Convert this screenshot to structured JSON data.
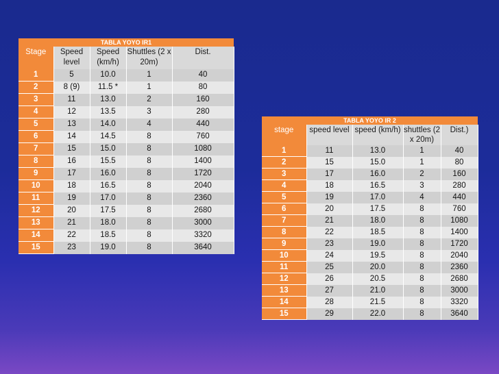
{
  "table1": {
    "title": "TABLA YOYO IR1",
    "headers": [
      "Stage",
      "Speed level",
      "Speed (km/h)",
      "Shuttles (2 x 20m)",
      "Dist."
    ],
    "rows": [
      [
        "1",
        "5",
        "10.0",
        "1",
        "40"
      ],
      [
        "2",
        "8 (9)",
        "11.5 *",
        "1",
        "80"
      ],
      [
        "3",
        "11",
        "13.0",
        "2",
        "160"
      ],
      [
        "4",
        "12",
        "13.5",
        "3",
        "280"
      ],
      [
        "5",
        "13",
        "14.0",
        "4",
        "440"
      ],
      [
        "6",
        "14",
        "14.5",
        "8",
        "760"
      ],
      [
        "7",
        "15",
        "15.0",
        "8",
        "1080"
      ],
      [
        "8",
        "16",
        "15.5",
        "8",
        "1400"
      ],
      [
        "9",
        "17",
        "16.0",
        "8",
        "1720"
      ],
      [
        "10",
        "18",
        "16.5",
        "8",
        "2040"
      ],
      [
        "11",
        "19",
        "17.0",
        "8",
        "2360"
      ],
      [
        "12",
        "20",
        "17.5",
        "8",
        "2680"
      ],
      [
        "13",
        "21",
        "18.0",
        "8",
        "3000"
      ],
      [
        "14",
        "22",
        "18.5",
        "8",
        "3320"
      ],
      [
        "15",
        "23",
        "19.0",
        "8",
        "3640"
      ]
    ]
  },
  "table2": {
    "title": "TABLA YOYO IR 2",
    "headers": [
      "stage",
      "speed level",
      "speed (km/h)",
      "shuttles (2 x 20m)",
      "Dist.)"
    ],
    "rows": [
      [
        "1",
        "11",
        "13.0",
        "1",
        "40"
      ],
      [
        "2",
        "15",
        "15.0",
        "1",
        "80"
      ],
      [
        "3",
        "17",
        "16.0",
        "2",
        "160"
      ],
      [
        "4",
        "18",
        "16.5",
        "3",
        "280"
      ],
      [
        "5",
        "19",
        "17.0",
        "4",
        "440"
      ],
      [
        "6",
        "20",
        "17.5",
        "8",
        "760"
      ],
      [
        "7",
        "21",
        "18.0",
        "8",
        "1080"
      ],
      [
        "8",
        "22",
        "18.5",
        "8",
        "1400"
      ],
      [
        "9",
        "23",
        "19.0",
        "8",
        "1720"
      ],
      [
        "10",
        "24",
        "19.5",
        "8",
        "2040"
      ],
      [
        "11",
        "25",
        "20.0",
        "8",
        "2360"
      ],
      [
        "12",
        "26",
        "20.5",
        "8",
        "2680"
      ],
      [
        "13",
        "27",
        "21.0",
        "8",
        "3000"
      ],
      [
        "14",
        "28",
        "21.5",
        "8",
        "3320"
      ],
      [
        "15",
        "29",
        "22.0",
        "8",
        "3640"
      ]
    ]
  }
}
